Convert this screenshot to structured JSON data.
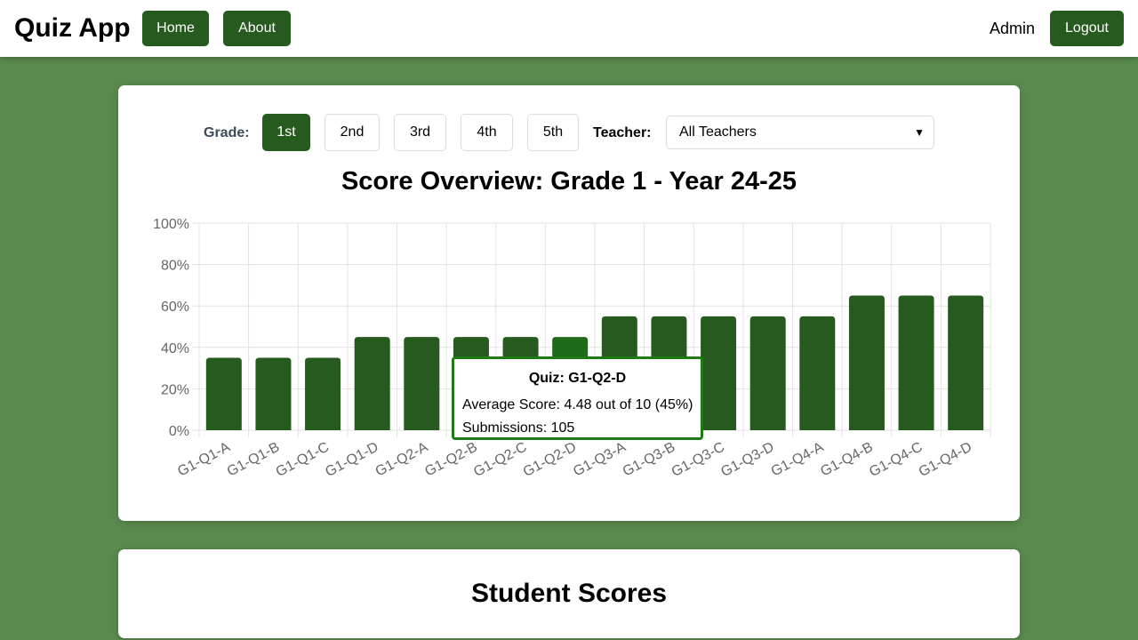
{
  "nav": {
    "brand": "Quiz App",
    "home_label": "Home",
    "about_label": "About",
    "user_label": "Admin",
    "logout_label": "Logout"
  },
  "filters": {
    "grade_label": "Grade:",
    "grades": [
      "1st",
      "2nd",
      "3rd",
      "4th",
      "5th"
    ],
    "selected_grade": "1st",
    "teacher_label": "Teacher:",
    "teacher_selected": "All Teachers"
  },
  "colors": {
    "accent": "#265a1e",
    "background": "#5a8a4e",
    "tooltip_border": "#1e7a12"
  },
  "chart_data": {
    "type": "bar",
    "title": "Score Overview: Grade 1 - Year 24-25",
    "categories": [
      "G1-Q1-A",
      "G1-Q1-B",
      "G1-Q1-C",
      "G1-Q1-D",
      "G1-Q2-A",
      "G1-Q2-B",
      "G1-Q2-C",
      "G1-Q2-D",
      "G1-Q3-A",
      "G1-Q3-B",
      "G1-Q3-C",
      "G1-Q3-D",
      "G1-Q4-A",
      "G1-Q4-B",
      "G1-Q4-C",
      "G1-Q4-D"
    ],
    "values": [
      35,
      35,
      35,
      45,
      45,
      45,
      45,
      45,
      55,
      55,
      55,
      55,
      55,
      65,
      65,
      65
    ],
    "ylim": [
      0,
      100
    ],
    "yticks": [
      "0%",
      "20%",
      "40%",
      "60%",
      "80%",
      "100%"
    ],
    "grid": true,
    "highlighted_index": 7
  },
  "tooltip": {
    "title": "Quiz: G1-Q2-D",
    "average": "Average Score: 4.48 out of 10 (45%)",
    "submissions": "Submissions: 105"
  },
  "students": {
    "title": "Student Scores"
  }
}
